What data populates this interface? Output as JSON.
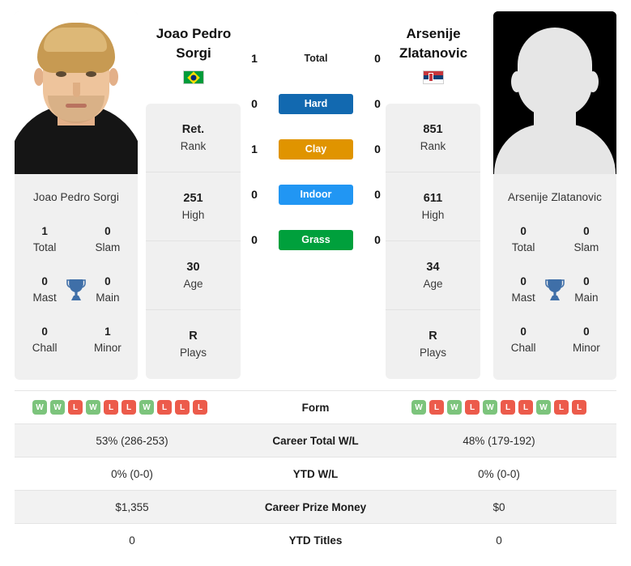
{
  "players": {
    "left": {
      "name_line1": "Joao Pedro",
      "name_line2": "Sorgi",
      "full_name": "Joao Pedro Sorgi",
      "country": "Brazil",
      "flag_icon": "brazil-flag-icon",
      "photo_alt": "Joao Pedro Sorgi",
      "info": [
        {
          "value": "Ret.",
          "label": "Rank"
        },
        {
          "value": "251",
          "label": "High"
        },
        {
          "value": "30",
          "label": "Age"
        },
        {
          "value": "R",
          "label": "Plays"
        }
      ],
      "titles": {
        "total": "1",
        "slam": "0",
        "mast": "0",
        "main": "0",
        "chall": "0",
        "minor": "1"
      },
      "h2h": {
        "total": "1",
        "hard": "0",
        "clay": "1",
        "indoor": "0",
        "grass": "0"
      },
      "form": [
        "W",
        "W",
        "L",
        "W",
        "L",
        "L",
        "W",
        "L",
        "L",
        "L"
      ],
      "career_total_wl": "53% (286-253)",
      "ytd_wl": "0% (0-0)",
      "career_prize_money": "$1,355",
      "ytd_titles": "0"
    },
    "right": {
      "name_line1": "Arsenije",
      "name_line2": "Zlatanovic",
      "full_name": "Arsenije Zlatanovic",
      "country": "Serbia",
      "flag_icon": "serbia-flag-icon",
      "photo_alt": "Arsenije Zlatanovic",
      "info": [
        {
          "value": "851",
          "label": "Rank"
        },
        {
          "value": "611",
          "label": "High"
        },
        {
          "value": "34",
          "label": "Age"
        },
        {
          "value": "R",
          "label": "Plays"
        }
      ],
      "titles": {
        "total": "0",
        "slam": "0",
        "mast": "0",
        "main": "0",
        "chall": "0",
        "minor": "0"
      },
      "h2h": {
        "total": "0",
        "hard": "0",
        "clay": "0",
        "indoor": "0",
        "grass": "0"
      },
      "form": [
        "W",
        "L",
        "W",
        "L",
        "W",
        "L",
        "L",
        "W",
        "L",
        "L"
      ],
      "career_total_wl": "48% (179-192)",
      "ytd_wl": "0% (0-0)",
      "career_prize_money": "$0",
      "ytd_titles": "0"
    }
  },
  "h2h_rows": [
    {
      "key": "total",
      "label": "Total",
      "badge": false,
      "color": ""
    },
    {
      "key": "hard",
      "label": "Hard",
      "badge": true,
      "color": "#1269b0"
    },
    {
      "key": "clay",
      "label": "Clay",
      "badge": true,
      "color": "#e09400"
    },
    {
      "key": "indoor",
      "label": "Indoor",
      "badge": true,
      "color": "#2196f3"
    },
    {
      "key": "grass",
      "label": "Grass",
      "badge": true,
      "color": "#00a03c"
    }
  ],
  "titles_labels": {
    "total": "Total",
    "slam": "Slam",
    "mast": "Mast",
    "main": "Main",
    "chall": "Chall",
    "minor": "Minor",
    "trophy_icon": "trophy-icon"
  },
  "table_rows": [
    {
      "label": "Form",
      "type": "form"
    },
    {
      "label": "Career Total W/L",
      "type": "text",
      "field": "career_total_wl"
    },
    {
      "label": "YTD W/L",
      "type": "text",
      "field": "ytd_wl"
    },
    {
      "label": "Career Prize Money",
      "type": "text",
      "field": "career_prize_money"
    },
    {
      "label": "YTD Titles",
      "type": "text",
      "field": "ytd_titles"
    }
  ],
  "colors": {
    "hard": "#1269b0",
    "clay": "#e09400",
    "indoor": "#2196f3",
    "grass": "#00a03c",
    "win": "#7cc47c",
    "loss": "#ec5b4b",
    "trophy": "#3f6fa8",
    "panel_bg": "#f0f0f0",
    "row_alt_bg": "#f2f2f2"
  }
}
